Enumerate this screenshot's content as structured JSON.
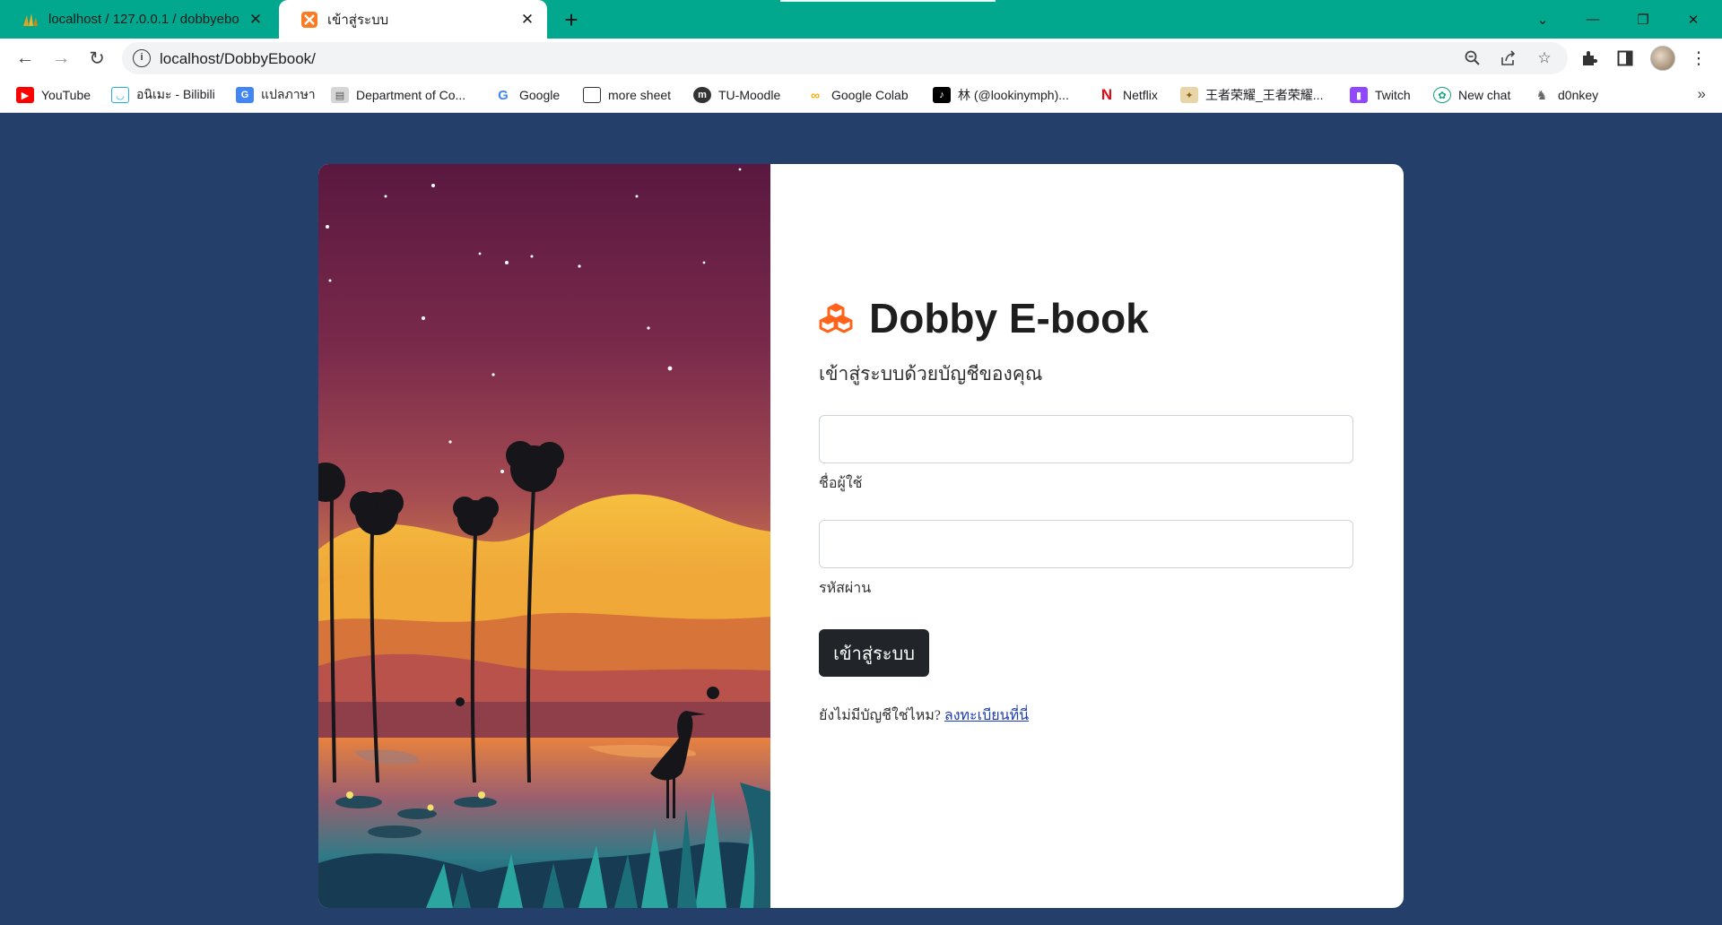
{
  "browser": {
    "tabs": [
      {
        "title": "localhost / 127.0.0.1 / dobbyebo",
        "icon": "phpmyadmin-icon",
        "active": false
      },
      {
        "title": "เข้าสู่ระบบ",
        "icon": "xampp-icon",
        "active": true
      }
    ],
    "url": "localhost/DobbyEbook/",
    "bookmarks": [
      {
        "label": "YouTube",
        "icon": "youtube-icon",
        "color": "#ff0000"
      },
      {
        "label": "อนิเมะ - Bilibili",
        "icon": "bilibili-icon",
        "color": "#23ade5"
      },
      {
        "label": "แปลภาษา",
        "icon": "google-translate-icon",
        "color": "#4285f4"
      },
      {
        "label": "Department of Co...",
        "icon": "department-icon",
        "color": "#888888"
      },
      {
        "label": "Google",
        "icon": "google-icon",
        "color": "#4285f4"
      },
      {
        "label": "more sheet",
        "icon": "sheet-icon",
        "color": "#333333"
      },
      {
        "label": "TU-Moodle",
        "icon": "moodle-icon",
        "color": "#333333"
      },
      {
        "label": "Google Colab",
        "icon": "colab-icon",
        "color": "#f9ab00"
      },
      {
        "label": "林 (@lookinymph)...",
        "icon": "tiktok-icon",
        "color": "#000000"
      },
      {
        "label": "Netflix",
        "icon": "netflix-icon",
        "color": "#e50914"
      },
      {
        "label": "王者荣耀_王者荣耀...",
        "icon": "game-icon",
        "color": "#c79b3b"
      },
      {
        "label": "Twitch",
        "icon": "twitch-icon",
        "color": "#9146ff"
      },
      {
        "label": "New chat",
        "icon": "chatgpt-icon",
        "color": "#10a37f"
      },
      {
        "label": "d0nkey",
        "icon": "donkey-icon",
        "color": "#666666"
      }
    ],
    "bookmarks_more": "»"
  },
  "page": {
    "brand": "Dobby E-book",
    "subtitle": "เข้าสู่ระบบด้วยบัญชีของคุณ",
    "username_label": "ชื่อผู้ใช้",
    "username_value": "",
    "password_label": "รหัสผ่าน",
    "password_value": "",
    "submit_label": "เข้าสู่ระบบ",
    "signup_prompt": "ยังไม่มีบัญชีใช่ไหม?",
    "signup_link": "ลงทะเบียนที่นี่"
  },
  "colors": {
    "page_bg": "#24406a",
    "accent_orange": "#ff6219",
    "button_dark": "#212529",
    "tabstrip": "#01a88e"
  }
}
